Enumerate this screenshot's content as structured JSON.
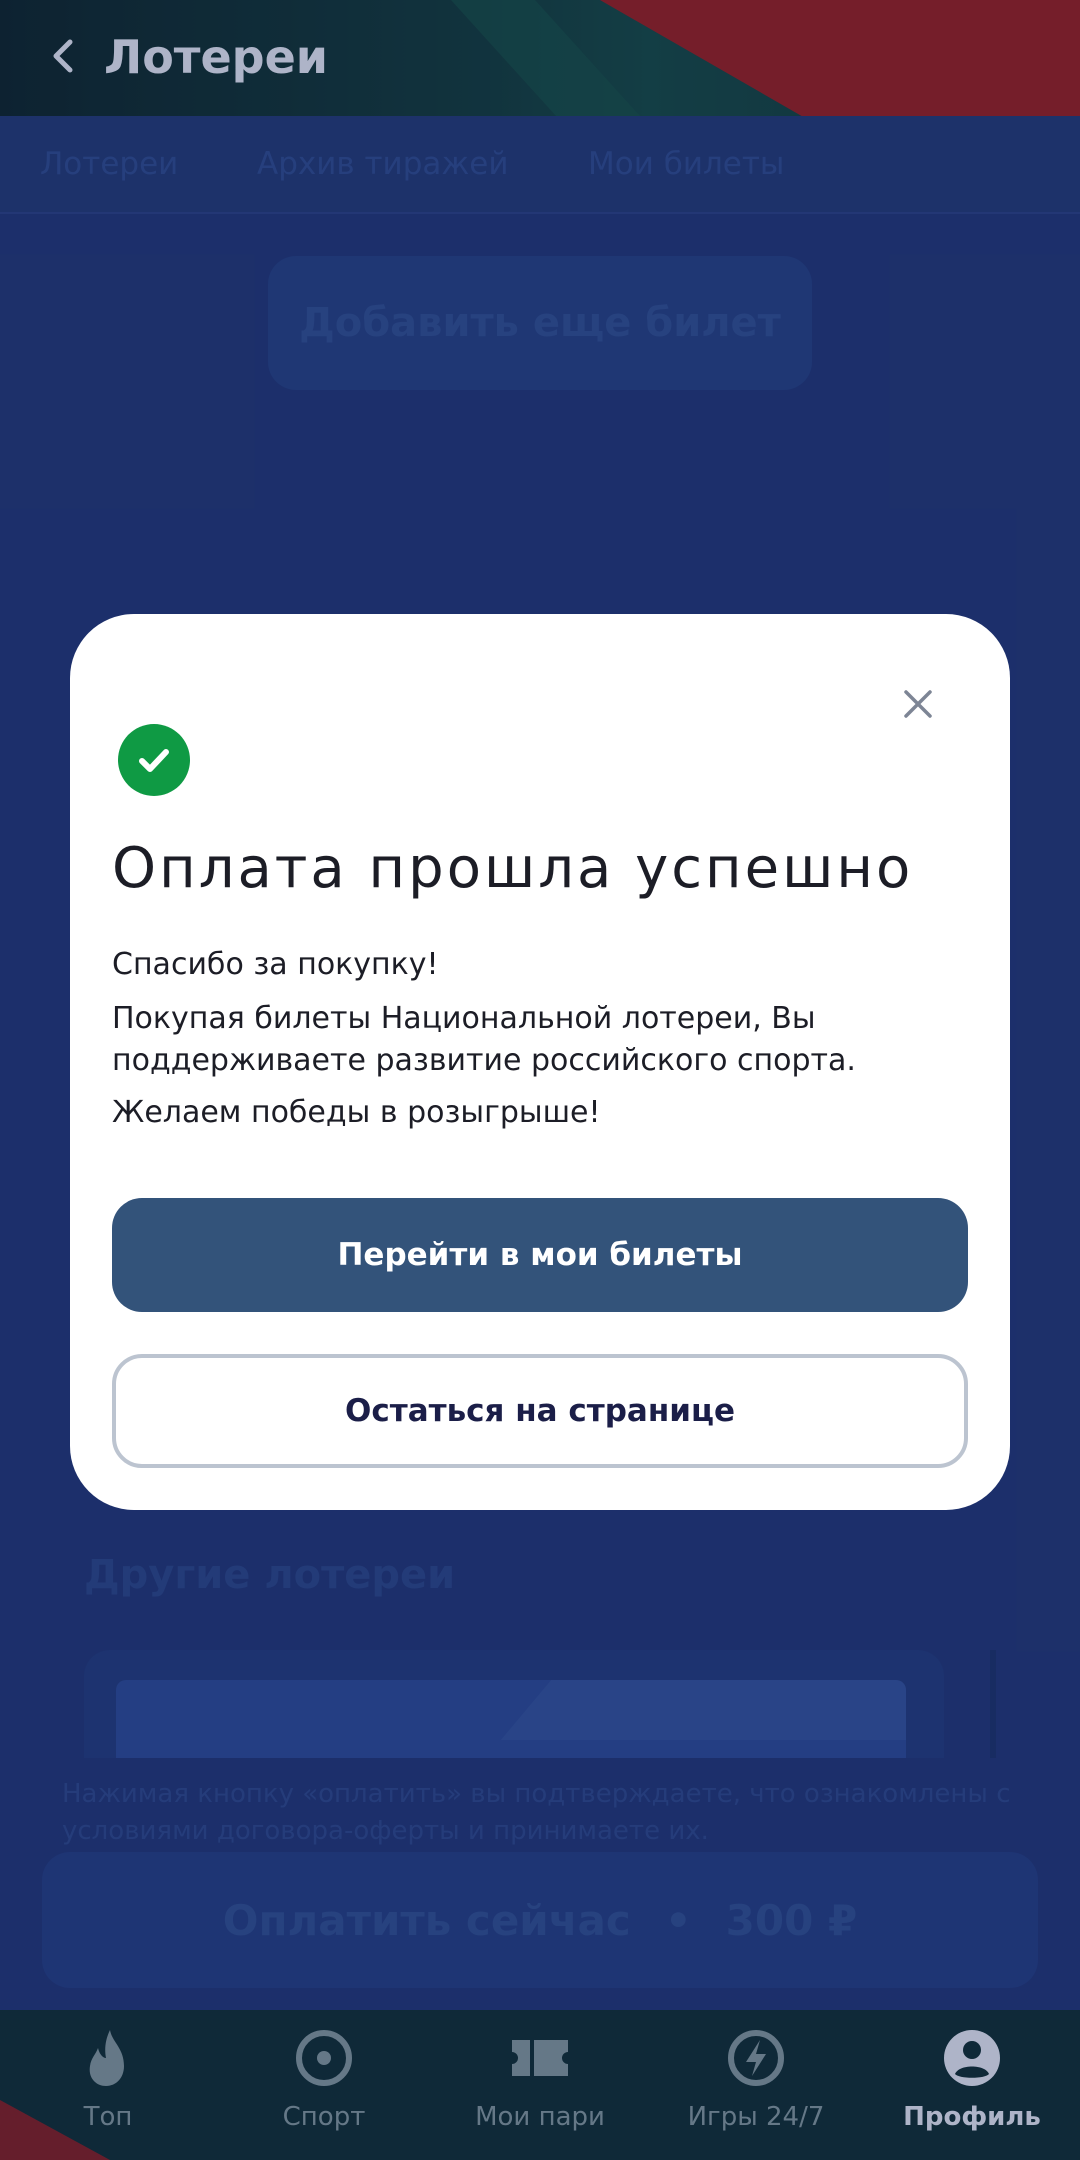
{
  "header": {
    "title": "Лотереи"
  },
  "tabs": [
    {
      "label": "Лотереи"
    },
    {
      "label": "Архив тиражей"
    },
    {
      "label": "Мои билеты"
    }
  ],
  "main": {
    "add_ticket_label": "Добавить еще билет",
    "other_lotteries_title": "Другие лотереи",
    "disclaimer": "Нажимая кнопку «оплатить» вы подтверждаете, что ознакомлены с условиями договора-оферты и принимаете их.",
    "pay_label": "Оплатить сейчас",
    "pay_separator": "•",
    "pay_amount": "300 ₽"
  },
  "modal": {
    "title": "Оплата прошла успешно",
    "text_1": "Спасибо за покупку!",
    "text_2": "Покупая билеты Национальной лотереи, Вы поддерживаете развитие российского спорта.",
    "text_3": "Желаем победы в розыгрыше!",
    "primary_button": "Перейти в мои билеты",
    "secondary_button": "Остаться на странице",
    "success_color": "#0f9a44"
  },
  "bottom_nav": [
    {
      "label": "Топ",
      "icon": "flame-icon"
    },
    {
      "label": "Спорт",
      "icon": "target-icon"
    },
    {
      "label": "Мои пари",
      "icon": "ticket-icon"
    },
    {
      "label": "Игры 24/7",
      "icon": "lightning-icon"
    },
    {
      "label": "Профиль",
      "icon": "profile-icon",
      "active": true
    }
  ]
}
